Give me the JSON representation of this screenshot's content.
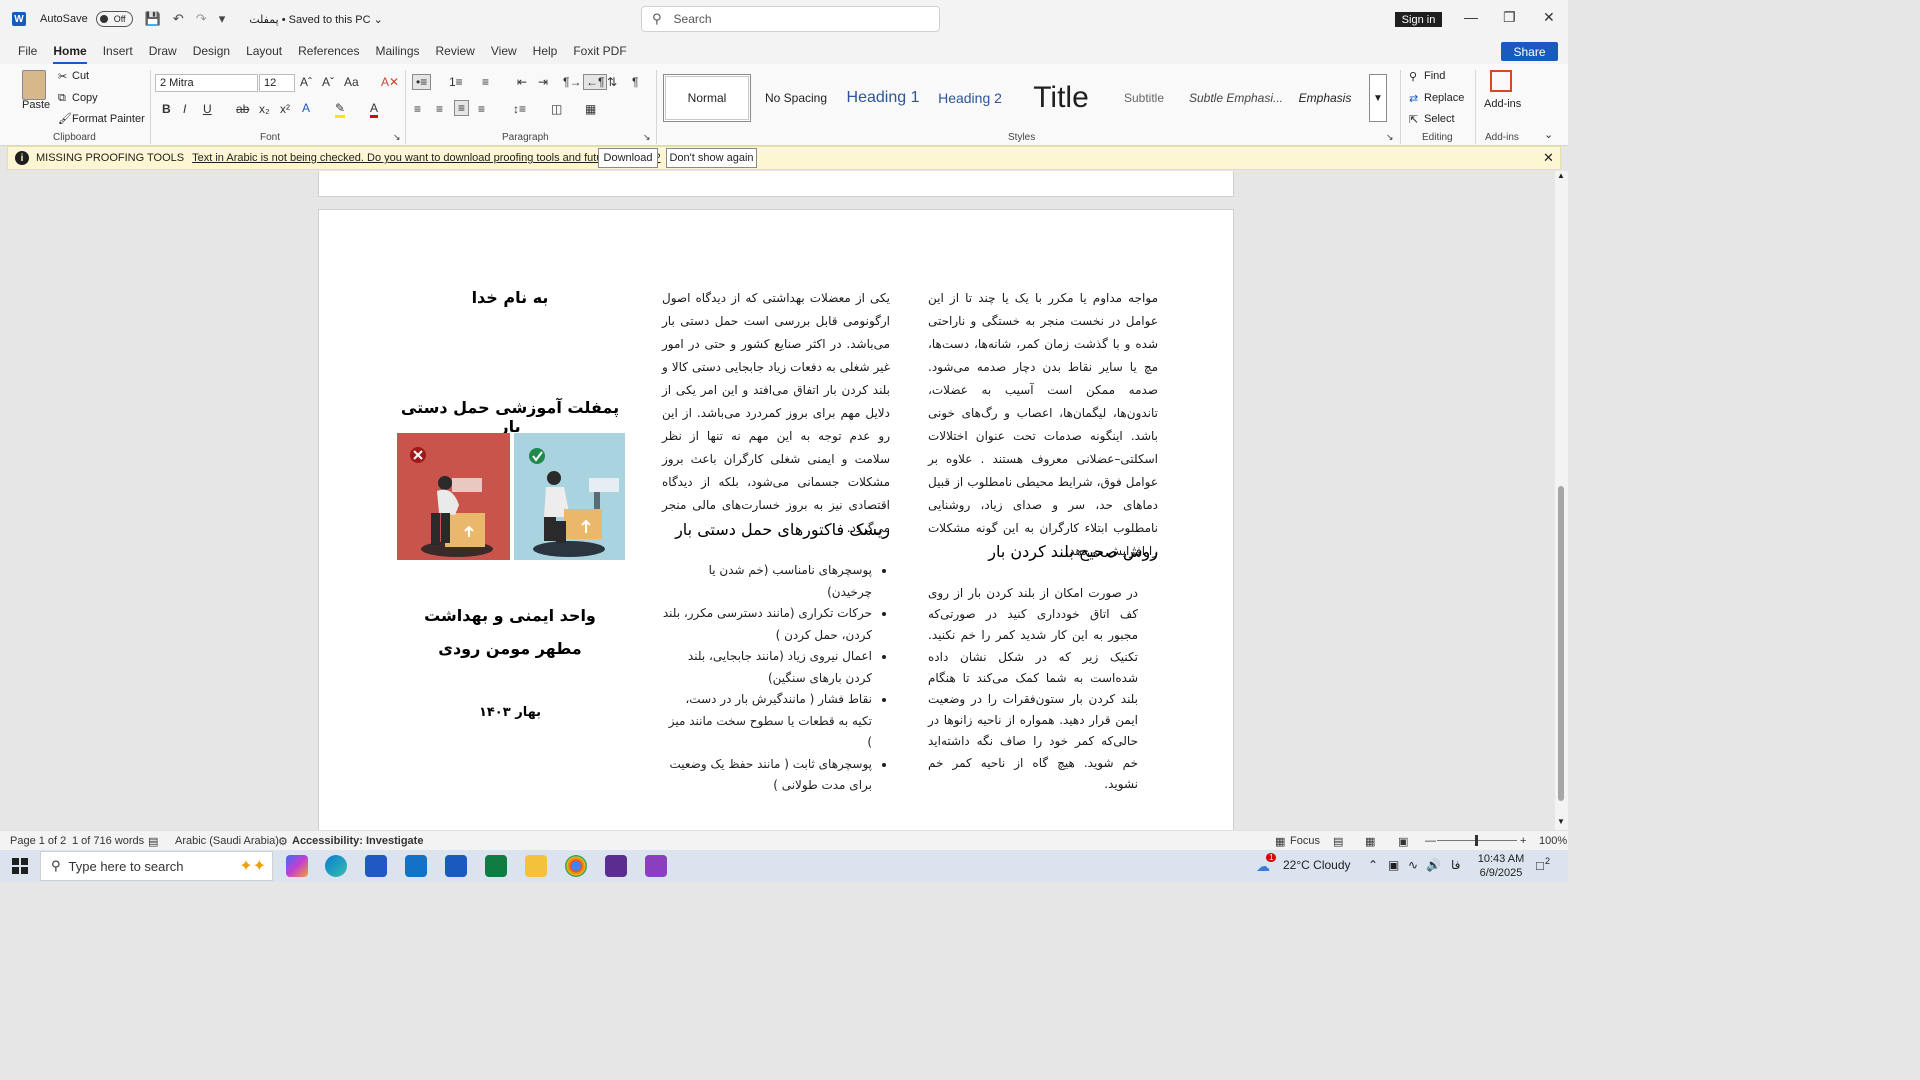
{
  "titlebar": {
    "autosave_label": "AutoSave",
    "autosave_state": "Off",
    "doc_title": "پمفلت",
    "save_status": "• Saved to this PC",
    "search_placeholder": "Search",
    "signin": "Sign in"
  },
  "ribbon_tabs": [
    "File",
    "Home",
    "Insert",
    "Draw",
    "Design",
    "Layout",
    "References",
    "Mailings",
    "Review",
    "View",
    "Help",
    "Foxit PDF"
  ],
  "share_label": "Share",
  "clipboard": {
    "paste": "Paste",
    "cut": "Cut",
    "copy": "Copy",
    "format_painter": "Format Painter",
    "group": "Clipboard"
  },
  "font": {
    "name": "2 Mitra",
    "size": "12",
    "group": "Font"
  },
  "paragraph": {
    "group": "Paragraph"
  },
  "styles": {
    "items": [
      "Normal",
      "No Spacing",
      "Heading 1",
      "Heading 2",
      "Title",
      "Subtitle",
      "Subtle Emphasi...",
      "Emphasis"
    ],
    "group": "Styles"
  },
  "editing": {
    "find": "Find",
    "replace": "Replace",
    "select": "Select",
    "group": "Editing"
  },
  "addins": {
    "button": "Add-ins",
    "group": "Add-ins"
  },
  "message_bar": {
    "title": "MISSING PROOFING TOOLS",
    "text": "Text in Arabic is not being checked. Do you want to download proofing tools and future updates?",
    "download": "Download",
    "dont_show": "Don't show again"
  },
  "document": {
    "cover": {
      "bismillah": "به نام خدا",
      "title": "پمفلت آموزشی حمل دستی بار",
      "unit": "واحد ایمنی و بهداشت",
      "author": "مطهر مومن رودی",
      "date": "بهار ۱۴۰۳"
    },
    "middle_paragraph": "یکی از معضلات بهداشتی که از دیدگاه اصول ارگونومی قابل بررسی است حمل دستی بار می‌باشد. در اکثر صنایع کشور و حتی در امور غیر شغلی به دفعات زیاد جابجایی دستی کالا و بلند کردن بار اتفاق می‌افتد و این امر یکی از دلایل مهم برای بروز کمردرد می‌باشد. از این رو عدم توجه به این مهم نه تنها از نظر سلامت و ایمنی شغلی کارگران باعث بروز مشکلات جسمانی می‌شود، بلکه از دیدگاه اقتصادی نیز به بروز خسارت‌های مالی منجر می‌گردد.",
    "risk_heading": "ریسک فاکتورهای حمل دستی بار",
    "risk_bullets": [
      "پوسچرهای نامناسب (خم شدن یا چرخیدن)",
      "حرکات تکراری (مانند دسترسی مکرر، بلند کردن، حمل کردن )",
      "اعمال نیروی زیاد (مانند جابجایی، بلند کردن بارهای سنگین)",
      "نقاط فشار ( مانندگیرش بار در دست، تکیه به قطعات یا سطوح سخت مانند میز )",
      "پوسچرهای ثابت ( مانند حفظ یک وضعیت برای مدت طولانی )"
    ],
    "right_paragraph": "مواجه مداوم یا مکرر با یک یا چند تا از این عوامل در نخست منجر به خستگی و ناراحتی شده و با گذشت زمان کمر، شانه‌ها، دست‌ها، مچ یا سایر نقاط بدن دچار صدمه می‌شود. صدمه ممکن است آسیب به عضلات، تاندون‌ها، لیگمان‌ها، اعصاب و رگ‌های خونی باشد. اینگونه صدمات تحت عنوان اختلالات اسکلتی–عضلانی معروف هستند . علاوه بر عوامل فوق، شرایط محیطی نامطلوب از قبیل دماهای حد، سر و صدای زیاد، روشنایی نامطلوب ابتلاء کارگران به این گونه مشکلات را افزایش می‌دهد.",
    "lift_heading": "روش صحیح بلند کردن بار",
    "lift_paragraph": "در صورت امکان از بلند کردن بار از روی کف اتاق خودداری کنید در صورتی‌که مجبور به این کار شدید کمر را خم نکنید. تکنیک زیر که در شکل نشان داده شده‌است به شما کمک می‌کند تا هنگام بلند کردن بار ستون‌فقرات را در وضعیت ایمن قرار دهید. همواره از ناحیه زانوها در حالی‌که کمر خود را صاف نگه داشته‌اید خم شوید. هیچ گاه از ناحیه کمر خم نشوید."
  },
  "statusbar": {
    "page": "Page 1 of 2",
    "words": "1 of 716 words",
    "language": "Arabic (Saudi Arabia)",
    "accessibility": "Accessibility: Investigate",
    "focus": "Focus",
    "zoom": "100%"
  },
  "taskbar": {
    "search_placeholder": "Type here to search",
    "weather": "22°C  Cloudy",
    "lang": "فا",
    "time": "10:43 AM",
    "date": "6/9/2025",
    "weather_badge": "1",
    "notif_count": "2"
  },
  "colors": {
    "accent": "#185abd",
    "msg_bg": "#fdf6d3",
    "illus_red": "#c9544c",
    "illus_blue": "#a9d3df"
  }
}
